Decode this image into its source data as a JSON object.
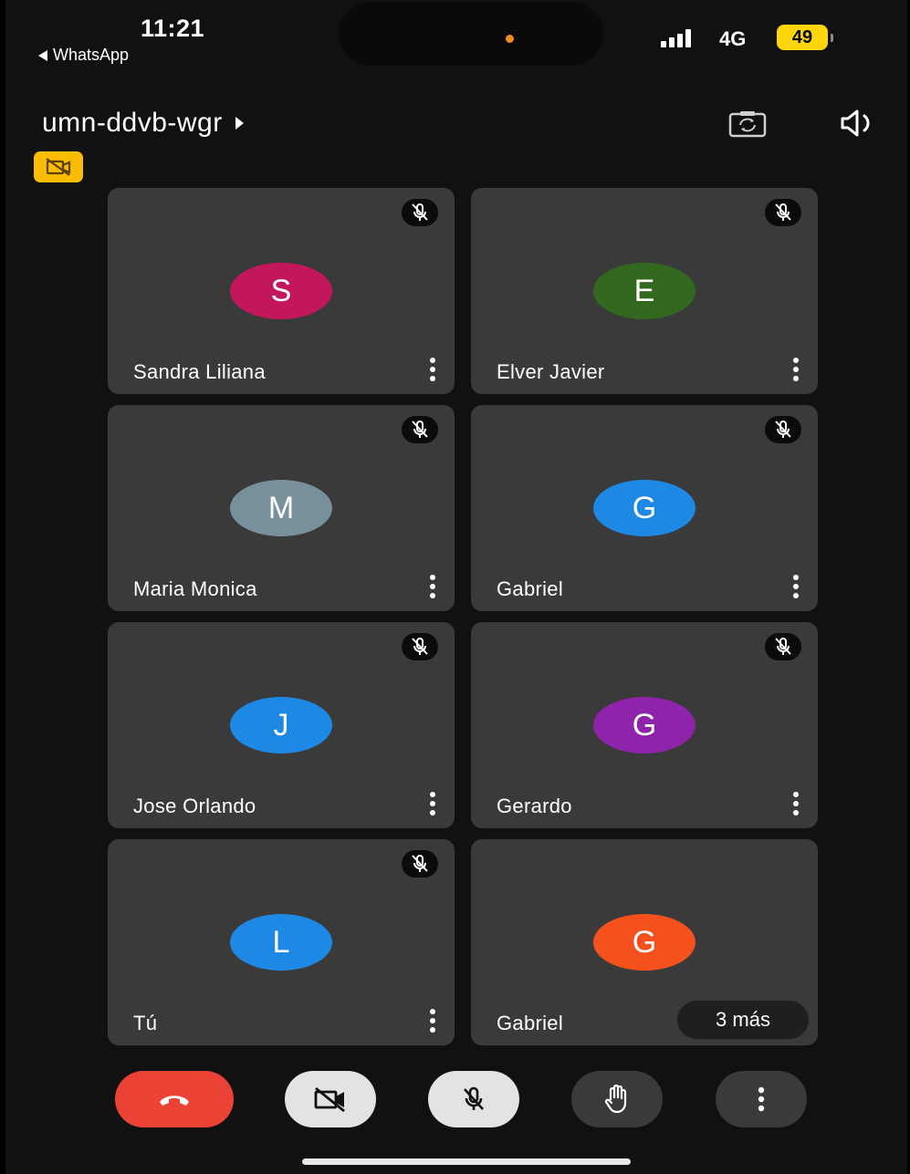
{
  "status_bar": {
    "time": "11:21",
    "back_app": "WhatsApp",
    "network": "4G",
    "battery": "49"
  },
  "call": {
    "meeting_code": "umn-ddvb-wgr"
  },
  "participants": [
    {
      "name": "Sandra Liliana",
      "initial": "S",
      "color": "#c2185b",
      "muted": true
    },
    {
      "name": "Elver Javier",
      "initial": "E",
      "color": "#33691e",
      "muted": true
    },
    {
      "name": "Maria Monica",
      "initial": "M",
      "color": "#78909c",
      "muted": true
    },
    {
      "name": "Gabriel",
      "initial": "G",
      "color": "#1e88e5",
      "muted": true
    },
    {
      "name": "Jose Orlando",
      "initial": "J",
      "color": "#1e88e5",
      "muted": true
    },
    {
      "name": "Gerardo",
      "initial": "G",
      "color": "#8e24aa",
      "muted": true
    },
    {
      "name": "Tú",
      "initial": "L",
      "color": "#1e88e5",
      "muted": true
    },
    {
      "name": "Gabriel",
      "initial": "G",
      "color": "#f4511e",
      "muted": false,
      "more_label": "3 más"
    }
  ],
  "controls": {
    "end_call_color": "#ea4335",
    "icons": [
      "phone-hangup-icon",
      "video-off-icon",
      "mic-off-icon",
      "raise-hand-icon",
      "more-vertical-icon"
    ]
  },
  "colors": {
    "background": "#111111",
    "tile": "#3a3a3a",
    "badge_yellow": "#fbbc04"
  }
}
